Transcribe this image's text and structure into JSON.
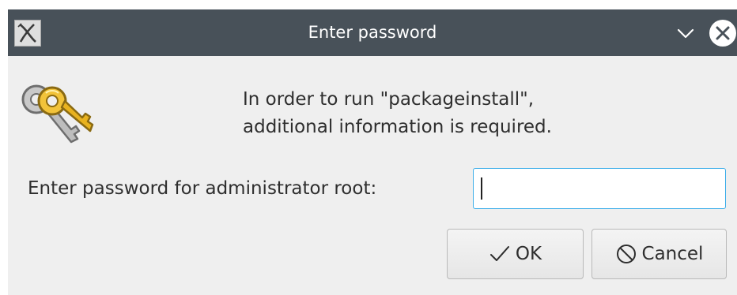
{
  "window": {
    "title": "Enter password",
    "icons": {
      "app": "app-icon",
      "minimize": "chevron-down-icon",
      "close": "close-icon"
    }
  },
  "dialog": {
    "icon": "keys-icon",
    "message_line1": "In order to run \"packageinstall\",",
    "message_line2": "additional information is required.",
    "password_label": "Enter password for administrator root:",
    "password_value": "",
    "ok_label": "OK",
    "cancel_label": "Cancel"
  },
  "colors": {
    "titlebar": "#485159",
    "background": "#efefef",
    "focus_border": "#3daee9",
    "text": "#2e2e2e"
  }
}
